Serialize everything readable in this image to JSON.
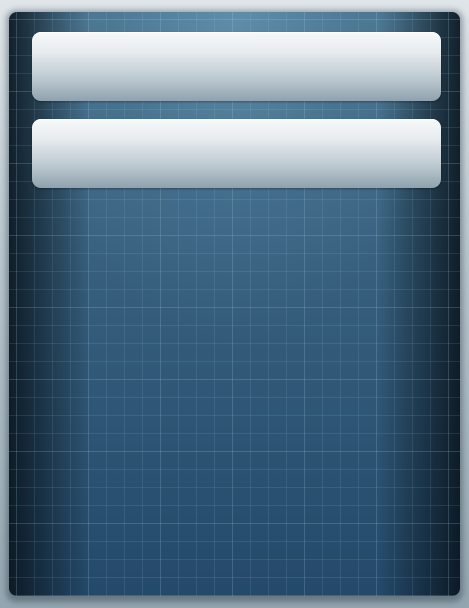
{
  "panel": {
    "slots": [
      {
        "label": ""
      },
      {
        "label": ""
      }
    ]
  },
  "colors": {
    "panel_top": "#4c7791",
    "panel_bottom": "#24496a",
    "slot_highlight": "#f7f9fa",
    "slot_shadow": "#8fa2ae"
  }
}
